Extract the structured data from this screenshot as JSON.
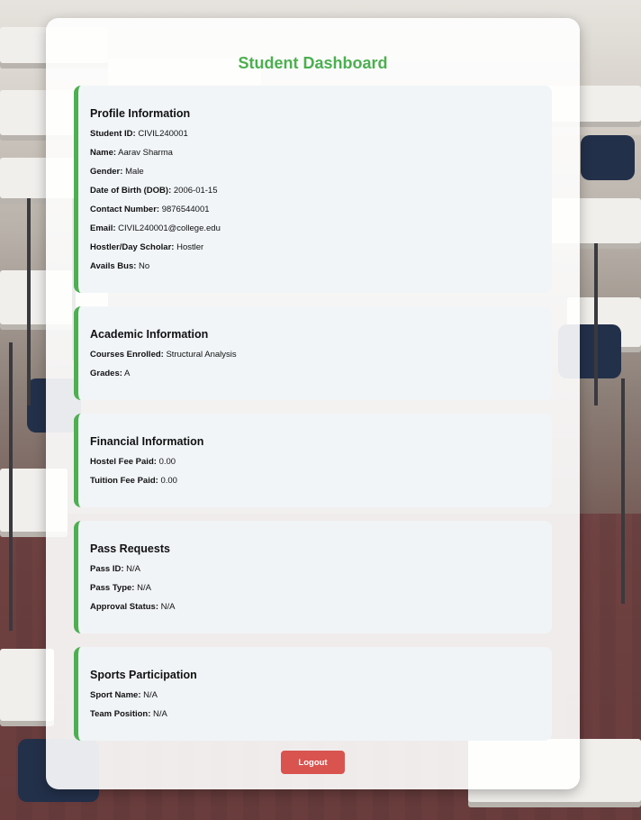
{
  "page": {
    "title": "Student Dashboard"
  },
  "profile": {
    "heading": "Profile Information",
    "fields": [
      {
        "label": "Student ID:",
        "value": "CIVIL240001"
      },
      {
        "label": "Name:",
        "value": "Aarav Sharma"
      },
      {
        "label": "Gender:",
        "value": "Male"
      },
      {
        "label": "Date of Birth (DOB):",
        "value": "2006-01-15"
      },
      {
        "label": "Contact Number:",
        "value": "9876544001"
      },
      {
        "label": "Email:",
        "value": "CIVIL240001@college.edu"
      },
      {
        "label": "Hostler/Day Scholar:",
        "value": "Hostler"
      },
      {
        "label": "Avails Bus:",
        "value": "No"
      }
    ]
  },
  "academic": {
    "heading": "Academic Information",
    "fields": [
      {
        "label": "Courses Enrolled:",
        "value": "Structural Analysis"
      },
      {
        "label": "Grades:",
        "value": "A"
      }
    ]
  },
  "financial": {
    "heading": "Financial Information",
    "fields": [
      {
        "label": "Hostel Fee Paid:",
        "value": "0.00"
      },
      {
        "label": "Tuition Fee Paid:",
        "value": "0.00"
      }
    ]
  },
  "pass": {
    "heading": "Pass Requests",
    "fields": [
      {
        "label": "Pass ID:",
        "value": "N/A"
      },
      {
        "label": "Pass Type:",
        "value": "N/A"
      },
      {
        "label": "Approval Status:",
        "value": "N/A"
      }
    ]
  },
  "sports": {
    "heading": "Sports Participation",
    "fields": [
      {
        "label": "Sport Name:",
        "value": "N/A"
      },
      {
        "label": "Team Position:",
        "value": "N/A"
      }
    ]
  },
  "actions": {
    "logout_label": "Logout"
  },
  "colors": {
    "accent": "#4caf50",
    "logout": "#d9534f",
    "section_bg": "#f0f4f8"
  }
}
